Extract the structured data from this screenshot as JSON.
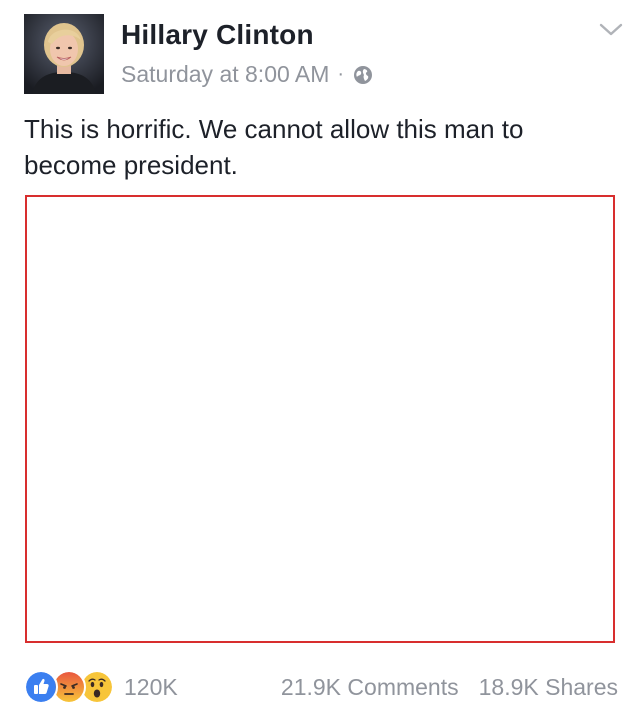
{
  "post": {
    "author": "Hillary Clinton",
    "timestamp": "Saturday at 8:00 AM",
    "separator": "·",
    "privacy_icon": "globe-icon",
    "menu_icon": "chevron-down-icon",
    "text": "This is horrific. We cannot allow this man to become president."
  },
  "footer": {
    "reactions": [
      "like-icon",
      "angry-icon",
      "wow-icon"
    ],
    "reaction_count": "120K",
    "comments": "21.9K Comments",
    "shares": "18.9K Shares"
  },
  "colors": {
    "media_border": "#d82e2e",
    "meta_text": "#90949c",
    "like_blue": "#3b7ff0",
    "angry_red": "#e9573f",
    "wow_yellow": "#f7c53a"
  }
}
